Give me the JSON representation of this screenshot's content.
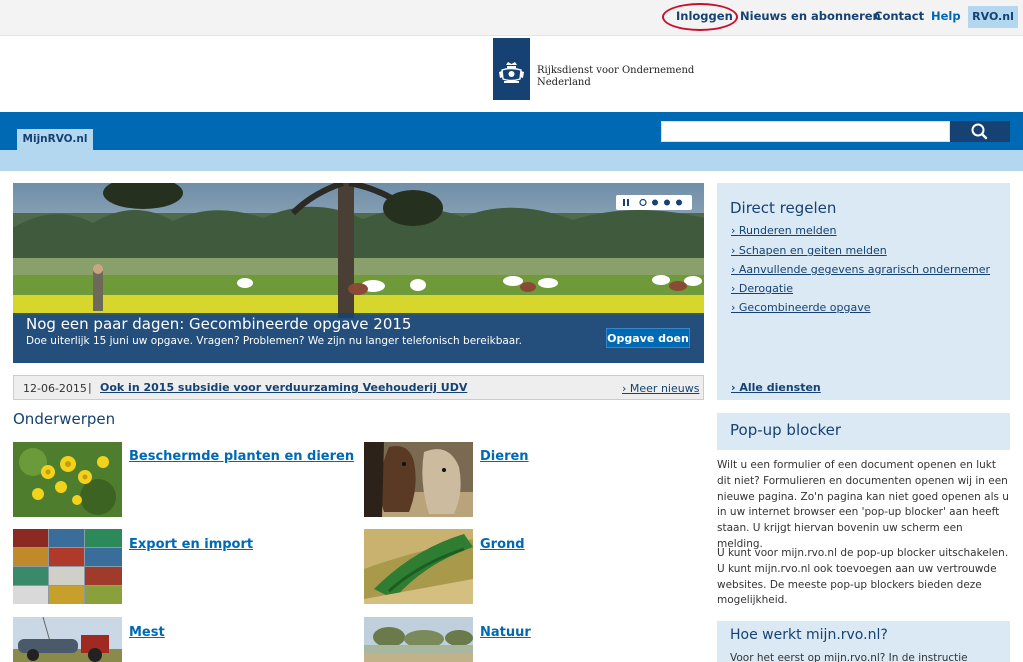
{
  "topbar": {
    "login": "Inloggen",
    "news": "Nieuws en abonneren",
    "contact": "Contact",
    "help": "Help",
    "site": "RVO.nl"
  },
  "logo": {
    "line1": "Rijksdienst voor Ondernemend",
    "line2": "Nederland"
  },
  "nav": {
    "tab": "MijnRVO.nl",
    "search_value": ""
  },
  "hero": {
    "title": "Nog een paar dagen: Gecombineerde opgave 2015",
    "subtitle": "Doe uiterlijk 15 juni uw opgave. Vragen? Problemen? We zijn nu langer telefonisch bereikbaar.",
    "button": "Opgave doen",
    "slides": 4,
    "active_slide": 1
  },
  "news": {
    "date": "12-06-2015",
    "separator": "|",
    "headline": "Ook in 2015 subsidie voor verduurzaming Veehouderij UDV",
    "more": "Meer nieuws"
  },
  "topics": {
    "title": "Onderwerpen",
    "items": [
      {
        "label": "Beschermde planten en dieren"
      },
      {
        "label": "Dieren"
      },
      {
        "label": "Export en import"
      },
      {
        "label": "Grond"
      },
      {
        "label": "Mest"
      },
      {
        "label": "Natuur"
      }
    ]
  },
  "direct": {
    "title": "Direct regelen",
    "items": [
      {
        "label": "Runderen melden"
      },
      {
        "label": "Schapen en geiten melden"
      },
      {
        "label": "Aanvullende gegevens agrarisch ondernemer"
      },
      {
        "label": "Derogatie"
      },
      {
        "label": "Gecombineerde opgave"
      }
    ],
    "all": "Alle diensten"
  },
  "popup": {
    "title": "Pop-up blocker",
    "p1": "Wilt u een formulier of een document openen en lukt dit niet? Formulieren en documenten openen wij in een nieuwe pagina. Zo'n pagina kan niet goed openen als u in uw internet browser een 'pop-up blocker' aan heeft staan. U krijgt hiervan bovenin uw scherm een melding.",
    "p2": "U kunt voor mijn.rvo.nl de pop-up blocker uitschakelen. U kunt mijn.rvo.nl ook toevoegen aan uw vertrouwde websites. De meeste pop-up blockers bieden deze mogelijkheid."
  },
  "hoe": {
    "title": "Hoe werkt mijn.rvo.nl?",
    "sub": "Voor het eerst op mijn.rvo.nl? In de instructie"
  },
  "colors": {
    "brand_dark": "#154273",
    "brand_blue": "#0069b3",
    "light_blue": "#b2d7ee",
    "panel": "#dbe9f4",
    "highlight": "#c8102e"
  }
}
